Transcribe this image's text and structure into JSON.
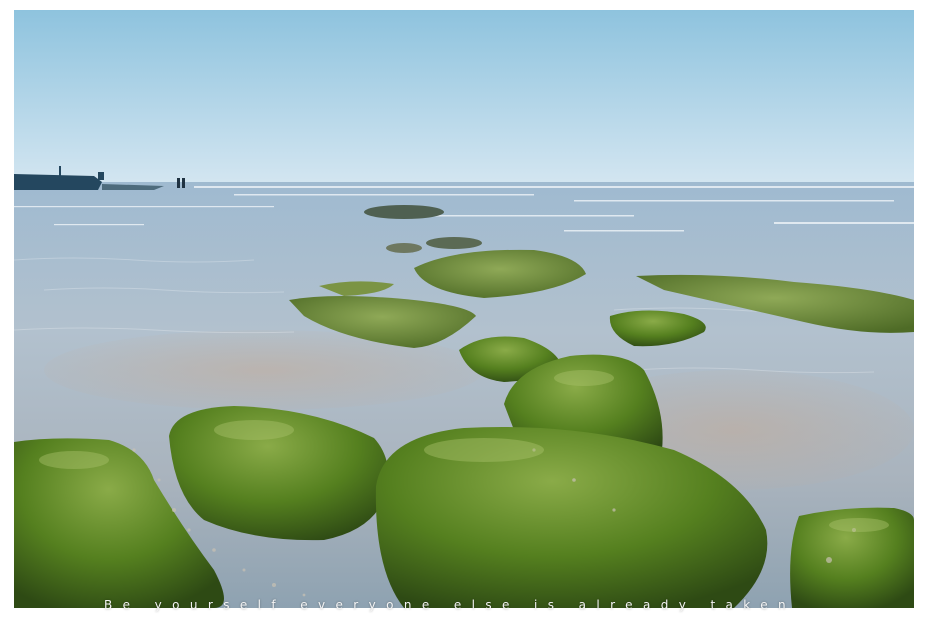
{
  "photo": {
    "subject": "seashore with green moss-covered rocks in shallow water",
    "colors": {
      "sky_top": "#8fc4de",
      "sky_horizon": "#d6e8f2",
      "sea": "#a7bccb",
      "moss": "#4f7a22",
      "moss_light": "#86a845"
    }
  },
  "caption": "Be yourself everyone else is already taken"
}
